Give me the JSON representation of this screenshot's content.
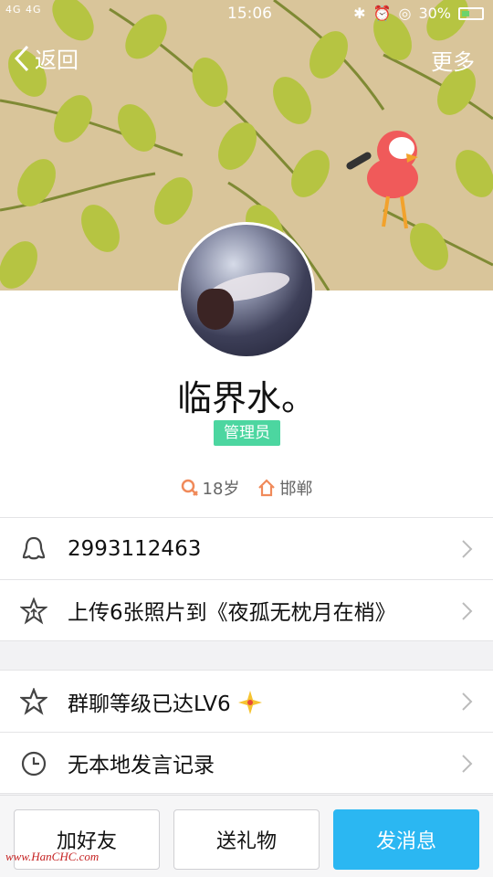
{
  "status": {
    "left": "4G 4G",
    "time": "15:06",
    "battery": "30%"
  },
  "nav": {
    "back": "返回",
    "more": "更多"
  },
  "profile": {
    "name": "临界水。",
    "role": "管理员",
    "age": "18岁",
    "location": "邯郸"
  },
  "rows": [
    {
      "icon": "qq-penguin-icon",
      "text": "2993112463"
    },
    {
      "icon": "star-upload-icon",
      "text": "上传6张照片到《夜孤无枕月在梢》"
    }
  ],
  "rows2": [
    {
      "icon": "level-star-icon",
      "text": "群聊等级已达LV6"
    },
    {
      "icon": "clock-icon",
      "text": "无本地发言记录"
    }
  ],
  "bottom": {
    "add": "加好友",
    "gift": "送礼物",
    "message": "发消息"
  },
  "watermark": "www.HanCHC.com",
  "colors": {
    "banner": "#d9c59a",
    "leaf": "#b6c442",
    "badge": "#4cd6a0",
    "primary": "#2bb7f2"
  }
}
